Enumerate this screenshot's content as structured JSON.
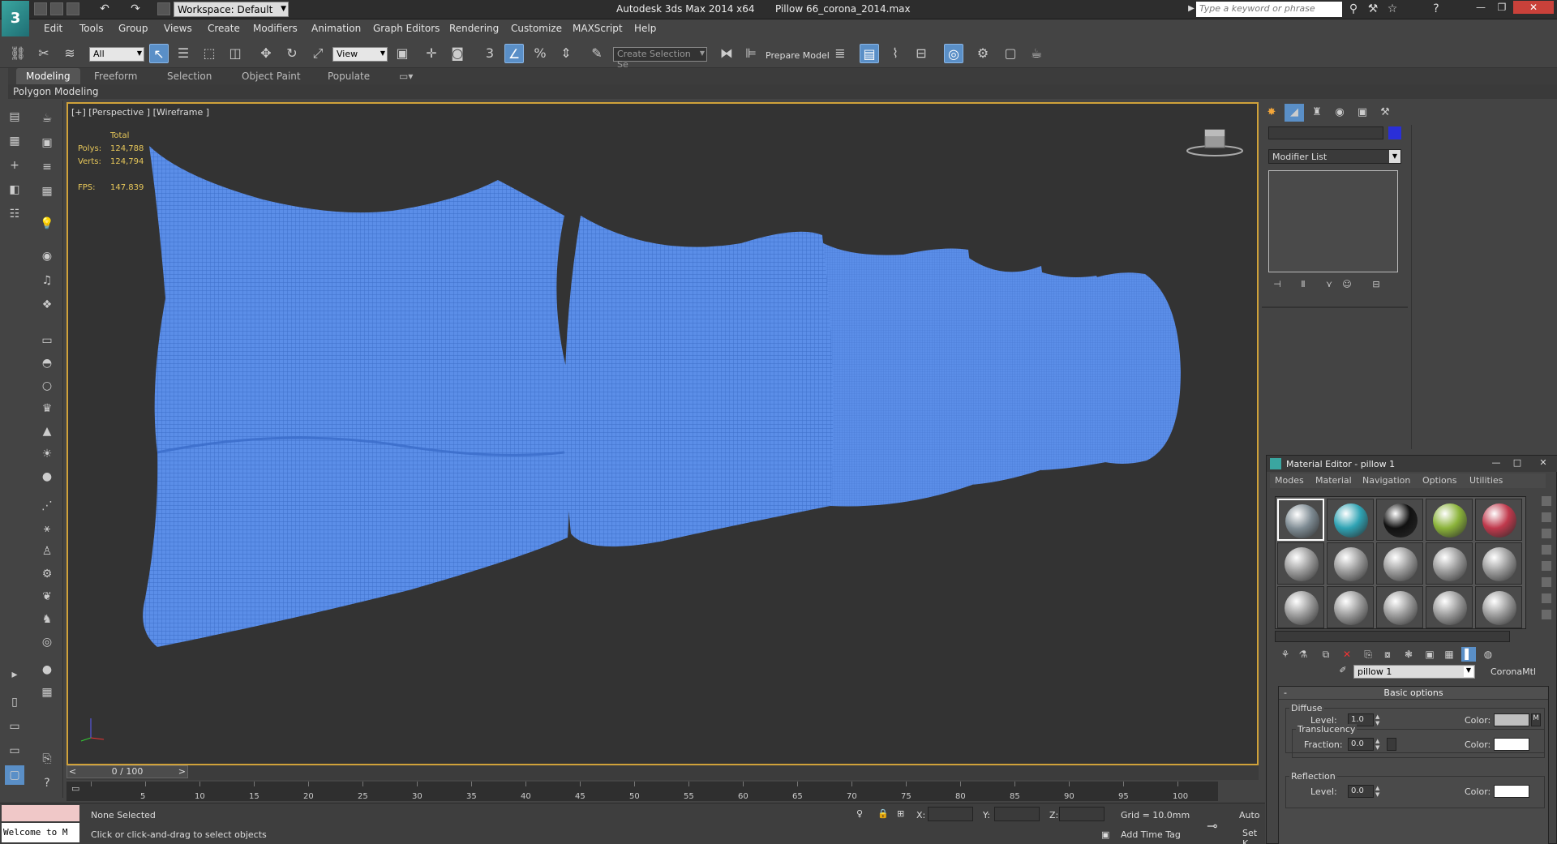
{
  "title_bar": {
    "workspace_label": "Workspace: Default",
    "app_title": "Autodesk 3ds Max  2014 x64",
    "file_name": "Pillow 66_corona_2014.max",
    "search_placeholder": "Type a keyword or phrase"
  },
  "menu": [
    "Edit",
    "Tools",
    "Group",
    "Views",
    "Create",
    "Modifiers",
    "Animation",
    "Graph Editors",
    "Rendering",
    "Customize",
    "MAXScript",
    "Help"
  ],
  "main_toolbar": {
    "selection_filter": "All",
    "ref_coord": "View",
    "snap_value": "3",
    "angle_snap": "%",
    "named_selection": "Create Selection Se",
    "prepare_model": "Prepare Model"
  },
  "ribbon": {
    "tabs": [
      "Modeling",
      "Freeform",
      "Selection",
      "Object Paint",
      "Populate"
    ],
    "active_tab": "Modeling",
    "panel_label": "Polygon Modeling"
  },
  "viewport": {
    "label": "[+] [Perspective ] [Wireframe ]",
    "stats": {
      "header": "Total",
      "polys_label": "Polys:",
      "polys_value": "124,788",
      "verts_label": "Verts:",
      "verts_value": "124,794",
      "fps_label": "FPS:",
      "fps_value": "147.839"
    },
    "wireframe_color": "#5b8ee8"
  },
  "timeline": {
    "slider_text": "0 / 100",
    "prev": "<",
    "next": ">",
    "ticks": [
      "5",
      "10",
      "15",
      "20",
      "25",
      "30",
      "35",
      "40",
      "45",
      "50",
      "55",
      "60",
      "65",
      "70",
      "75",
      "80",
      "85",
      "90",
      "95",
      "100"
    ]
  },
  "status": {
    "script_line": "Welcome to M",
    "selection": "None Selected",
    "prompt": "Click or click-and-drag to select objects",
    "x_label": "X:",
    "y_label": "Y:",
    "z_label": "Z:",
    "grid": "Grid = 10.0mm",
    "add_time_tag": "Add Time Tag",
    "auto_key": "Auto",
    "set_key": "Set K"
  },
  "command_panel": {
    "modifier_list": "Modifier List",
    "object_color": "#2a2fd8"
  },
  "material_editor": {
    "title": "Material Editor - pillow 1",
    "menu": [
      "Modes",
      "Material",
      "Navigation",
      "Options",
      "Utilities"
    ],
    "material_name": "pillow 1",
    "material_type": "CoronaMtl",
    "slots": [
      {
        "color": "#7d8a92"
      },
      {
        "color": "#2fa3b4"
      },
      {
        "color": "#111111"
      },
      {
        "color": "#8bb33a"
      },
      {
        "color": "#c0394c"
      },
      {
        "color": "#9a9a9a"
      },
      {
        "color": "#9a9a9a"
      },
      {
        "color": "#9a9a9a"
      },
      {
        "color": "#9a9a9a"
      },
      {
        "color": "#9a9a9a"
      },
      {
        "color": "#9a9a9a"
      },
      {
        "color": "#9a9a9a"
      },
      {
        "color": "#9a9a9a"
      },
      {
        "color": "#9a9a9a"
      },
      {
        "color": "#9a9a9a"
      }
    ],
    "rollout_title": "Basic options",
    "diffuse": {
      "group": "Diffuse",
      "level_label": "Level:",
      "level": "1.0",
      "color_label": "Color:",
      "color": "#bfbfbf",
      "map_button": "M"
    },
    "translucency": {
      "group": "Translucency",
      "fraction_label": "Fraction:",
      "fraction": "0.0",
      "color_label": "Color:",
      "color": "#ffffff"
    },
    "reflection": {
      "group": "Reflection",
      "level_label": "Level:",
      "level": "0.0",
      "color_label": "Color:",
      "color": "#ffffff"
    }
  }
}
